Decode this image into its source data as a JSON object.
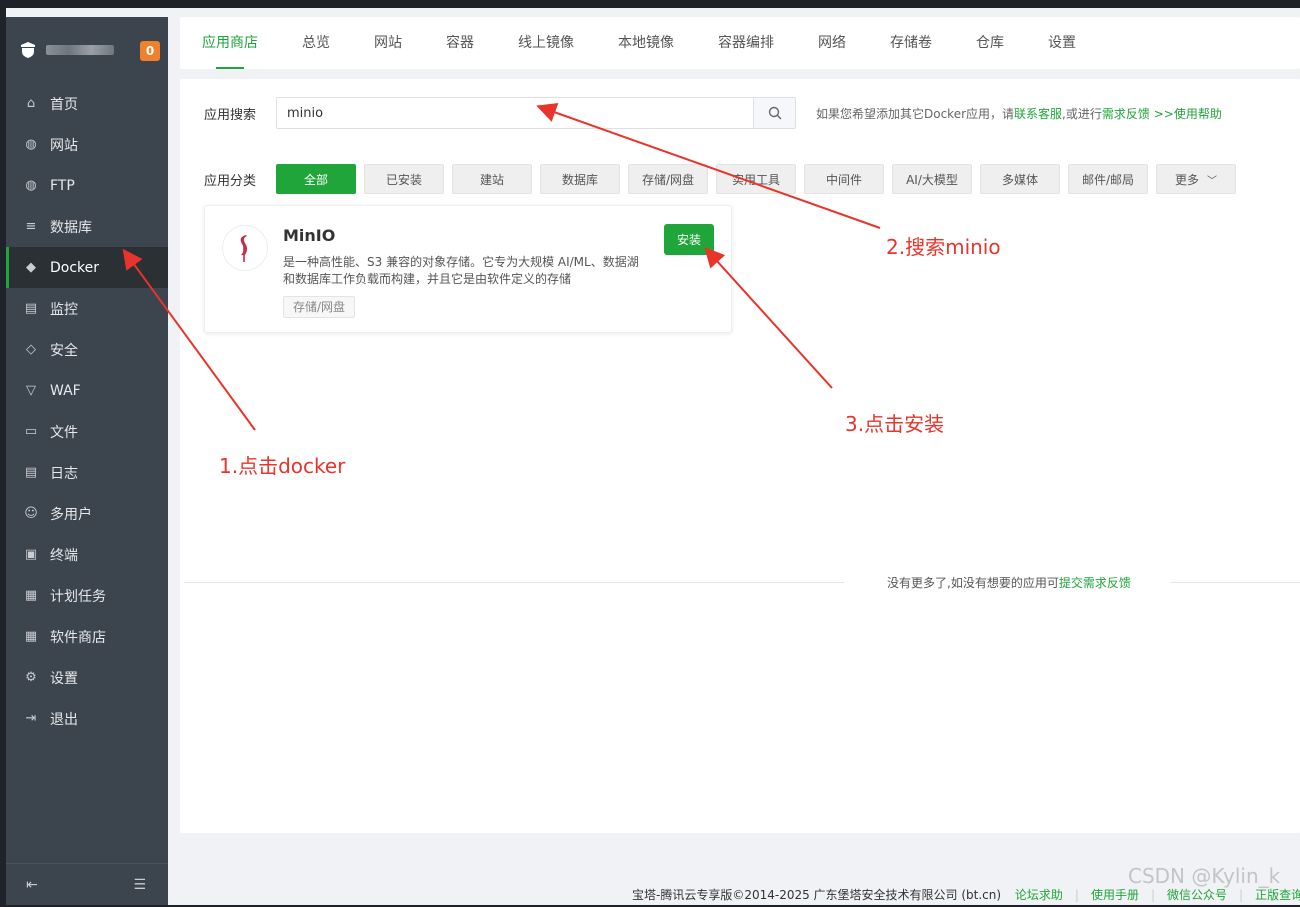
{
  "sidebar": {
    "badge": "0",
    "items": [
      {
        "label": "首页",
        "icon": "home-icon",
        "glyph": "⌂"
      },
      {
        "label": "网站",
        "icon": "globe-icon",
        "glyph": "◍"
      },
      {
        "label": "FTP",
        "icon": "ftp-globe-icon",
        "glyph": "◍"
      },
      {
        "label": "数据库",
        "icon": "database-icon",
        "glyph": "≡"
      },
      {
        "label": "Docker",
        "icon": "docker-icon",
        "glyph": "◆"
      },
      {
        "label": "监控",
        "icon": "monitor-icon",
        "glyph": "▤"
      },
      {
        "label": "安全",
        "icon": "shield-icon",
        "glyph": "◇"
      },
      {
        "label": "WAF",
        "icon": "waf-shield-icon",
        "glyph": "▽"
      },
      {
        "label": "文件",
        "icon": "folder-icon",
        "glyph": "▭"
      },
      {
        "label": "日志",
        "icon": "log-icon",
        "glyph": "▤"
      },
      {
        "label": "多用户",
        "icon": "users-icon",
        "glyph": "☺"
      },
      {
        "label": "终端",
        "icon": "terminal-icon",
        "glyph": "▣"
      },
      {
        "label": "计划任务",
        "icon": "calendar-icon",
        "glyph": "▦"
      },
      {
        "label": "软件商店",
        "icon": "apps-grid-icon",
        "glyph": "▦"
      },
      {
        "label": "设置",
        "icon": "gear-icon",
        "glyph": "⚙"
      },
      {
        "label": "退出",
        "icon": "logout-icon",
        "glyph": "⇥"
      }
    ]
  },
  "tabs": [
    "应用商店",
    "总览",
    "网站",
    "容器",
    "线上镜像",
    "本地镜像",
    "容器编排",
    "网络",
    "存储卷",
    "仓库",
    "设置"
  ],
  "search": {
    "label": "应用搜索",
    "value": "minio",
    "help_prefix": "如果您希望添加其它Docker应用，请",
    "help_link1": "联系客服",
    "help_mid": ",或进行",
    "help_link2": "需求反馈",
    "help_link3": " >>使用帮助"
  },
  "categories": {
    "label": "应用分类",
    "items": [
      "全部",
      "已安装",
      "建站",
      "数据库",
      "存储/网盘",
      "实用工具",
      "中间件",
      "AI/大模型",
      "多媒体",
      "邮件/邮局",
      "更多"
    ]
  },
  "app_card": {
    "title": "MinIO",
    "description": "是一种高性能、S3 兼容的对象存储。它专为大规模 AI/ML、数据湖和数据库工作负载而构建，并且它是由软件定义的存储",
    "tag": "存储/网盘",
    "install_label": "安装"
  },
  "no_more": {
    "text": "没有更多了,如没有想要的应用可",
    "link": "提交需求反馈"
  },
  "footer": {
    "copyright": "宝塔-腾讯云专享版©2014-2025 广东堡塔安全技术有限公司 (bt.cn)",
    "links": [
      "论坛求助",
      "使用手册",
      "微信公众号",
      "正版查询"
    ]
  },
  "watermark": "CSDN @Kylin_k",
  "annotations": {
    "step1": "1.点击docker",
    "step2": "2.搜索minio",
    "step3": "3.点击安装"
  },
  "colors": {
    "accent": "#20a53a",
    "sidebar_bg": "#3c444d",
    "annotation": "#e8342b",
    "badge": "#f0802c"
  }
}
